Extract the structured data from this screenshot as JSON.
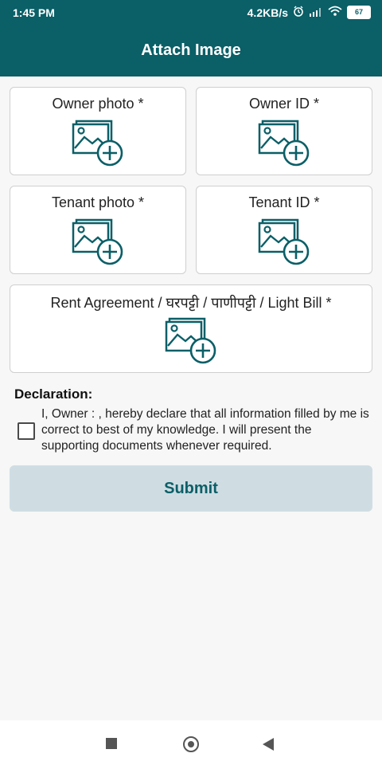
{
  "status_bar": {
    "time": "1:45 PM",
    "speed": "4.2KB/s",
    "battery": "67",
    "icons": [
      "alarm-icon",
      "signal-icon",
      "wifi-icon",
      "battery-icon"
    ]
  },
  "header": {
    "title": "Attach Image"
  },
  "attachments": [
    {
      "label": "Owner photo *",
      "icon": "add-image-icon"
    },
    {
      "label": "Owner ID *",
      "icon": "add-image-icon"
    },
    {
      "label": "Tenant photo *",
      "icon": "add-image-icon"
    },
    {
      "label": "Tenant ID *",
      "icon": "add-image-icon"
    },
    {
      "label": "Rent Agreement / घरपट्टी / पाणीपट्टी / Light Bill *",
      "icon": "add-image-icon"
    }
  ],
  "declaration": {
    "title": "Declaration:",
    "text": "I, Owner : , hereby declare that all information filled by me is correct to best of my knowledge. I will present the supporting documents whenever required.",
    "checked": false
  },
  "submit": {
    "label": "Submit"
  },
  "colors": {
    "primary": "#0b5f67",
    "submit_bg": "#cfdde3",
    "background": "#f7f7f7"
  }
}
